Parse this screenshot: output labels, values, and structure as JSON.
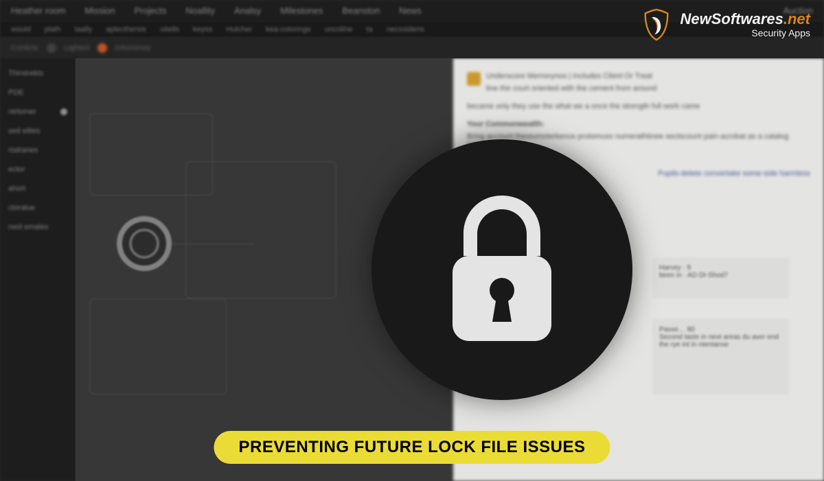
{
  "brand": {
    "name_main": "NewSoftwares",
    "name_tld": ".net",
    "tagline": "Security Apps"
  },
  "caption": "PREVENTING FUTURE LOCK FILE ISSUES",
  "topMenu": {
    "items": [
      "Heather room",
      "Mission",
      "Projects",
      "Noallity",
      "Analsy",
      "Milestones",
      "Beanston",
      "News"
    ],
    "side": "Auction"
  },
  "subToolbar": {
    "items": [
      "would",
      "plath",
      "taally",
      "aplecthersis",
      "oitells",
      "keyss",
      "Hulcher",
      "kea-colorings",
      "uncoline",
      "ta",
      "necssidens"
    ]
  },
  "breadcrumb": {
    "items": [
      "Conticts",
      "Lighted",
      "Informiney"
    ]
  },
  "sidebar": {
    "items": [
      {
        "label": "Thirstrekts"
      },
      {
        "label": "PDE"
      },
      {
        "label": "ntrtomer"
      },
      {
        "label": "sed elites"
      },
      {
        "label": "rodranes"
      },
      {
        "label": "ector"
      },
      {
        "label": "ahort"
      },
      {
        "label": "ctoralue"
      },
      {
        "label": "rwol emales"
      }
    ]
  },
  "overlay": {
    "title": "Underscore Memorynos | Includes Client Or Treat",
    "subtitle": "line the court oriented with the cement from around",
    "body1": "became only they use the what we a once the strength full work came",
    "heading2": "Your Commonwealth:",
    "body2": "Bring account thereumsterkence protomuss numerathtinee sectscount pain-acrobat as a catalog interest became",
    "link": "Pupils-delete convertake some-side harmless"
  },
  "cards": {
    "c1": {
      "line1": "Harvey · 9",
      "line2": "been in · AD DI-Shod7"
    },
    "c2": {
      "line1": "Passe… 80",
      "line2": "Second taste in next areas du aver end",
      "line3": "the rye int in ntentanse"
    }
  },
  "colors": {
    "accent_yellow": "#f7e838",
    "brand_orange": "#e28b1e",
    "bg_dark": "#2a2a2a",
    "badge_dark": "#1a1a1a"
  }
}
